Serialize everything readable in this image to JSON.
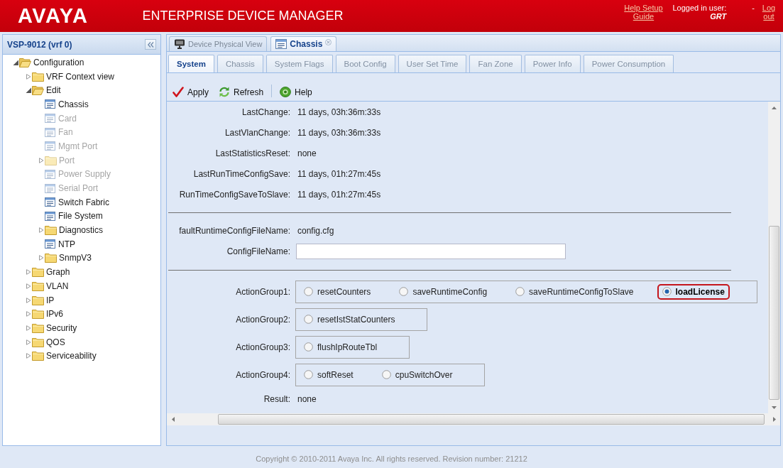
{
  "header": {
    "logo": "AVAYA",
    "title": "ENTERPRISE DEVICE MANAGER",
    "help_link": "Help Setup Guide",
    "user_label": "Logged in user:",
    "user_name": "GRT",
    "separator": "-",
    "logout_link": "Log out"
  },
  "sidebar": {
    "title": "VSP-9012 (vrf 0)",
    "tree": [
      {
        "label": "Configuration",
        "kind": "folder",
        "expanded": true,
        "disabled": false,
        "children": [
          {
            "label": "VRF Context view",
            "kind": "folder",
            "expanded": false,
            "disabled": false
          },
          {
            "label": "Edit",
            "kind": "folder",
            "expanded": true,
            "disabled": false,
            "children": [
              {
                "label": "Chassis",
                "kind": "leaf",
                "disabled": false
              },
              {
                "label": "Card",
                "kind": "leaf",
                "disabled": true
              },
              {
                "label": "Fan",
                "kind": "leaf",
                "disabled": true
              },
              {
                "label": "Mgmt Port",
                "kind": "leaf",
                "disabled": true
              },
              {
                "label": "Port",
                "kind": "folder",
                "expanded": false,
                "disabled": true
              },
              {
                "label": "Power Supply",
                "kind": "leaf",
                "disabled": true
              },
              {
                "label": "Serial Port",
                "kind": "leaf",
                "disabled": true
              },
              {
                "label": "Switch Fabric",
                "kind": "leaf",
                "disabled": false
              },
              {
                "label": "File System",
                "kind": "leaf",
                "disabled": false
              },
              {
                "label": "Diagnostics",
                "kind": "folder",
                "expanded": false,
                "disabled": false
              },
              {
                "label": "NTP",
                "kind": "leaf",
                "disabled": false
              },
              {
                "label": "SnmpV3",
                "kind": "folder",
                "expanded": false,
                "disabled": false
              }
            ]
          },
          {
            "label": "Graph",
            "kind": "folder",
            "expanded": false,
            "disabled": false
          },
          {
            "label": "VLAN",
            "kind": "folder",
            "expanded": false,
            "disabled": false
          },
          {
            "label": "IP",
            "kind": "folder",
            "expanded": false,
            "disabled": false
          },
          {
            "label": "IPv6",
            "kind": "folder",
            "expanded": false,
            "disabled": false
          },
          {
            "label": "Security",
            "kind": "folder",
            "expanded": false,
            "disabled": false
          },
          {
            "label": "QOS",
            "kind": "folder",
            "expanded": false,
            "disabled": false
          },
          {
            "label": "Serviceability",
            "kind": "folder",
            "expanded": false,
            "disabled": false
          }
        ]
      }
    ]
  },
  "document_tabs": [
    {
      "label": "Device Physical View",
      "kind": "physical",
      "selected": false,
      "closable": false
    },
    {
      "label": "Chassis",
      "kind": "form",
      "selected": true,
      "closable": true
    }
  ],
  "sub_tabs": [
    {
      "label": "System",
      "selected": true
    },
    {
      "label": "Chassis",
      "selected": false
    },
    {
      "label": "System Flags",
      "selected": false
    },
    {
      "label": "Boot Config",
      "selected": false
    },
    {
      "label": "User Set Time",
      "selected": false
    },
    {
      "label": "Fan Zone",
      "selected": false
    },
    {
      "label": "Power Info",
      "selected": false
    },
    {
      "label": "Power Consumption",
      "selected": false
    }
  ],
  "toolbar": [
    {
      "kind": "apply",
      "label": "Apply"
    },
    {
      "kind": "refresh",
      "label": "Refresh"
    },
    {
      "kind": "separator"
    },
    {
      "kind": "help",
      "label": "Help"
    }
  ],
  "form": {
    "sections": [
      {
        "rows": [
          {
            "kind": "text",
            "label": "LastChange:",
            "value": "11 days, 03h:36m:33s"
          },
          {
            "kind": "text",
            "label": "LastVlanChange:",
            "value": "11 days, 03h:36m:33s"
          },
          {
            "kind": "text",
            "label": "LastStatisticsReset:",
            "value": "none"
          },
          {
            "kind": "text",
            "label": "LastRunTimeConfigSave:",
            "value": "11 days, 01h:27m:45s"
          },
          {
            "kind": "text",
            "label": "RunTimeConfigSaveToSlave:",
            "value": "11 days, 01h:27m:45s"
          }
        ]
      },
      {
        "rows": [
          {
            "kind": "text",
            "label": "faultRuntimeConfigFileName:",
            "value": "config.cfg"
          },
          {
            "kind": "input",
            "label": "ConfigFileName:"
          }
        ]
      },
      {
        "rows": [
          {
            "kind": "radios",
            "label": "ActionGroup1:",
            "options": [
              {
                "label": "resetCounters",
                "selected": false,
                "highlighted": false
              },
              {
                "label": "saveRuntimeConfig",
                "selected": false,
                "highlighted": false
              },
              {
                "label": "saveRuntimeConfigToSlave",
                "selected": false,
                "highlighted": false
              },
              {
                "label": "loadLicense",
                "selected": true,
                "highlighted": true
              }
            ]
          },
          {
            "kind": "radios",
            "label": "ActionGroup2:",
            "options": [
              {
                "label": "resetIstStatCounters",
                "selected": false,
                "highlighted": false
              }
            ]
          },
          {
            "kind": "radios",
            "label": "ActionGroup3:",
            "options": [
              {
                "label": "flushIpRouteTbl",
                "selected": false,
                "highlighted": false
              }
            ]
          },
          {
            "kind": "radios",
            "label": "ActionGroup4:",
            "options": [
              {
                "label": "softReset",
                "selected": false,
                "highlighted": false
              },
              {
                "label": "cpuSwitchOver",
                "selected": false,
                "highlighted": false
              }
            ]
          },
          {
            "kind": "text",
            "label": "Result:",
            "value": "none"
          }
        ]
      }
    ]
  },
  "footer": "Copyright © 2010-2011 Avaya Inc. All rights reserved. Revision number: 21212"
}
